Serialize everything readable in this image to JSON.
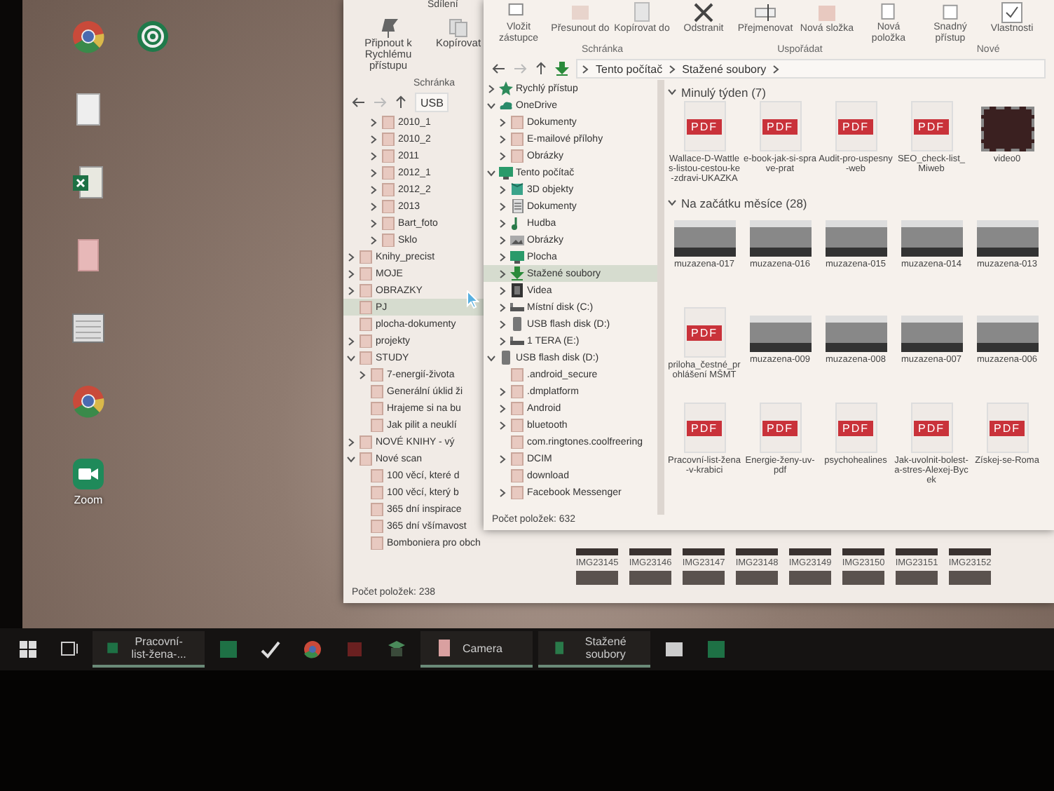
{
  "desktop_icons": [
    {
      "kind": "chrome"
    },
    {
      "kind": "spiral"
    },
    {
      "kind": "document"
    },
    {
      "kind": "excel"
    },
    {
      "kind": "pdf-file"
    },
    {
      "kind": "calendar"
    },
    {
      "kind": "chrome"
    },
    {
      "kind": "zoom",
      "label": "Zoom"
    }
  ],
  "back_window": {
    "ribbon_tab": "Sdílení",
    "ribbon_buttons": [
      "Připnout k Rychlému přístupu",
      "Kopírovat"
    ],
    "ribbon_group": "Schránka",
    "path": "USB",
    "tree": [
      {
        "children": [
          {
            "label": "2010_1",
            "expanded": false,
            "selected": false,
            "kind": "folder"
          },
          {
            "label": "2010_2",
            "expanded": false,
            "selected": false,
            "kind": "folder"
          },
          {
            "label": "2011",
            "expanded": false,
            "selected": false,
            "kind": "folder"
          },
          {
            "label": "2012_1",
            "expanded": false,
            "selected": false,
            "kind": "folder"
          },
          {
            "label": "2012_2",
            "expanded": false,
            "selected": false,
            "kind": "folder"
          },
          {
            "label": "2013",
            "expanded": false,
            "selected": false,
            "kind": "folder"
          },
          {
            "label": "Bart_foto",
            "expanded": false,
            "selected": false,
            "kind": "folder"
          },
          {
            "label": "Sklo",
            "expanded": false,
            "selected": false,
            "kind": "folder"
          }
        ]
      },
      {
        "label": "Knihy_precist",
        "expanded": false,
        "selected": false,
        "kind": "folder"
      },
      {
        "label": "MOJE",
        "expanded": false,
        "selected": false,
        "kind": "folder"
      },
      {
        "label": "OBRAZKY",
        "expanded": false,
        "selected": false,
        "kind": "folder"
      },
      {
        "label": "PJ",
        "selected": true,
        "kind": "folder"
      },
      {
        "label": "plocha-dokumenty",
        "selected": false,
        "kind": "folder"
      },
      {
        "label": "projekty",
        "expanded": false,
        "selected": false,
        "kind": "folder"
      },
      {
        "label": "STUDY",
        "expanded": true,
        "selected": false,
        "kind": "folder",
        "children": [
          {
            "label": "7-energií-života",
            "expanded": false,
            "selected": false,
            "kind": "folder"
          },
          {
            "label": "Generální úklid ži",
            "selected": false,
            "kind": "folder"
          },
          {
            "label": "Hrajeme si na bu",
            "selected": false,
            "kind": "folder"
          },
          {
            "label": "Jak pilit a neuklí",
            "selected": false,
            "kind": "folder"
          }
        ]
      },
      {
        "label": "NOVÉ KNIHY - vý",
        "expanded": false,
        "selected": false,
        "kind": "folder"
      },
      {
        "label": "Nové scan",
        "expanded": true,
        "selected": false,
        "kind": "folder",
        "children": [
          {
            "label": "100 věcí, které d",
            "selected": false,
            "kind": "folder"
          },
          {
            "label": "100 věcí, který b",
            "selected": false,
            "kind": "folder"
          },
          {
            "label": "365 dní inspirace",
            "selected": false,
            "kind": "folder"
          },
          {
            "label": "365 dní všímavost",
            "selected": false,
            "kind": "folder"
          },
          {
            "label": "Bomboniera pro obch",
            "selected": false,
            "kind": "folder"
          }
        ]
      }
    ],
    "thumbnails": [
      "IMG23145",
      "IMG23146",
      "IMG23147",
      "IMG23148",
      "IMG23149",
      "IMG23150",
      "IMG23151",
      "IMG23152"
    ],
    "status": "Počet položek: 238"
  },
  "front_window": {
    "ribbon_buttons": [
      {
        "label": "Vložit zástupce",
        "kind": "shortcut"
      },
      {
        "label": "Přesunout do",
        "kind": "move"
      },
      {
        "label": "Kopírovat do",
        "kind": "copy"
      },
      {
        "label": "Odstranit",
        "kind": "delete"
      },
      {
        "label": "Přejmenovat",
        "kind": "rename"
      },
      {
        "label": "Nová složka",
        "kind": "folder"
      },
      {
        "label": "Nová položka",
        "kind": "new"
      },
      {
        "label": "Snadný přístup",
        "kind": "easy"
      },
      {
        "label": "Vlastnosti",
        "kind": "properties"
      }
    ],
    "ribbon_groups": [
      "Schránka",
      "Uspořádat",
      "Nové"
    ],
    "breadcrumb": [
      "Tento počítač",
      "Stažené soubory"
    ],
    "tree": [
      {
        "label": "Rychlý přístup",
        "expanded": false,
        "selected": false,
        "kind": "star"
      },
      {
        "label": "OneDrive",
        "expanded": true,
        "selected": false,
        "kind": "cloud",
        "children": [
          {
            "label": "Dokumenty",
            "expanded": false,
            "selected": false,
            "kind": "folder"
          },
          {
            "label": "E-mailové přílohy",
            "expanded": false,
            "selected": false,
            "kind": "folder"
          },
          {
            "label": "Obrázky",
            "expanded": false,
            "selected": false,
            "kind": "folder"
          }
        ]
      },
      {
        "label": "Tento počítač",
        "expanded": true,
        "selected": false,
        "kind": "monitor",
        "children": [
          {
            "label": "3D objekty",
            "expanded": false,
            "selected": false,
            "kind": "cube"
          },
          {
            "label": "Dokumenty",
            "expanded": false,
            "selected": false,
            "kind": "document"
          },
          {
            "label": "Hudba",
            "expanded": false,
            "selected": false,
            "kind": "music"
          },
          {
            "label": "Obrázky",
            "expanded": false,
            "selected": false,
            "kind": "picture"
          },
          {
            "label": "Plocha",
            "expanded": false,
            "selected": false,
            "kind": "monitor"
          },
          {
            "label": "Stažené soubory",
            "expanded": false,
            "selected": true,
            "kind": "download"
          },
          {
            "label": "Videa",
            "expanded": false,
            "selected": false,
            "kind": "film"
          },
          {
            "label": "Místní disk (C:)",
            "expanded": false,
            "selected": false,
            "kind": "drive"
          },
          {
            "label": "USB flash disk (D:)",
            "expanded": false,
            "selected": false,
            "kind": "usb"
          },
          {
            "label": "1 TERA (E:)",
            "expanded": false,
            "selected": false,
            "kind": "drive"
          }
        ]
      },
      {
        "label": "USB flash disk (D:)",
        "expanded": true,
        "selected": false,
        "kind": "usb",
        "children": [
          {
            "label": ".android_secure",
            "selected": false,
            "kind": "folder"
          },
          {
            "label": ".dmplatform",
            "expanded": false,
            "selected": false,
            "kind": "folder"
          },
          {
            "label": "Android",
            "expanded": false,
            "selected": false,
            "kind": "folder"
          },
          {
            "label": "bluetooth",
            "expanded": false,
            "selected": false,
            "kind": "folder"
          },
          {
            "label": "com.ringtones.coolfreering",
            "selected": false,
            "kind": "folder"
          },
          {
            "label": "DCIM",
            "expanded": false,
            "selected": false,
            "kind": "folder"
          },
          {
            "label": "download",
            "selected": false,
            "kind": "folder"
          },
          {
            "label": "Facebook Messenger",
            "expanded": false,
            "selected": false,
            "kind": "folder"
          }
        ]
      }
    ],
    "groups": [
      {
        "title": "Minulý týden (7)",
        "expanded": true,
        "items": [
          {
            "name": "Wallace-D-Wattles-listou-cestou-ke-zdravi-UKAZKA",
            "kind": "pdf",
            "badge": "PDF"
          },
          {
            "name": "e-book-jak-si-sprave-prat",
            "kind": "pdf",
            "badge": "PDF"
          },
          {
            "name": "Audit-pro-uspesny-web",
            "kind": "pdf",
            "badge": "PDF"
          },
          {
            "name": "SEO_check-list_Miweb",
            "kind": "pdf",
            "badge": "PDF"
          },
          {
            "name": "video0",
            "kind": "video"
          }
        ]
      },
      {
        "title": "Na začátku měsíce (28)",
        "expanded": true,
        "items": [
          {
            "name": "muzazena-017",
            "kind": "image"
          },
          {
            "name": "muzazena-016",
            "kind": "image"
          },
          {
            "name": "muzazena-015",
            "kind": "image"
          },
          {
            "name": "muzazena-014",
            "kind": "image"
          },
          {
            "name": "muzazena-013",
            "kind": "image"
          },
          {
            "name": "priloha_čestné_prohlášení MŠMT",
            "kind": "pdf",
            "badge": "PDF"
          },
          {
            "name": "muzazena-009",
            "kind": "image"
          },
          {
            "name": "muzazena-008",
            "kind": "image"
          },
          {
            "name": "muzazena-007",
            "kind": "image"
          },
          {
            "name": "muzazena-006",
            "kind": "image"
          },
          {
            "name": "Pracovní-list-žena-v-krabici",
            "kind": "pdf",
            "badge": "PDF"
          },
          {
            "name": "Energie-ženy-uv-pdf",
            "kind": "pdf",
            "badge": "PDF"
          },
          {
            "name": "psychohealines",
            "kind": "pdf",
            "badge": "PDF"
          },
          {
            "name": "Jak-uvolnit-bolest-a-stres-Alexej-Bycek",
            "kind": "pdf",
            "badge": "PDF"
          },
          {
            "name": "Získej-se-Roma",
            "kind": "pdf",
            "badge": "PDF"
          }
        ]
      }
    ],
    "status": "Počet položek: 632"
  },
  "taskbar": [
    {
      "kind": "start"
    },
    {
      "kind": "task-view"
    },
    {
      "kind": "excel",
      "label": "Pracovní-list-žena-...",
      "active": true
    },
    {
      "kind": "excel"
    },
    {
      "kind": "check"
    },
    {
      "kind": "chrome"
    },
    {
      "kind": "square"
    },
    {
      "kind": "box"
    },
    {
      "kind": "camera",
      "label": "Camera",
      "active": true
    },
    {
      "kind": "explorer",
      "label": "Stažené soubory",
      "active": true
    },
    {
      "kind": "photo"
    },
    {
      "kind": "excel"
    }
  ]
}
